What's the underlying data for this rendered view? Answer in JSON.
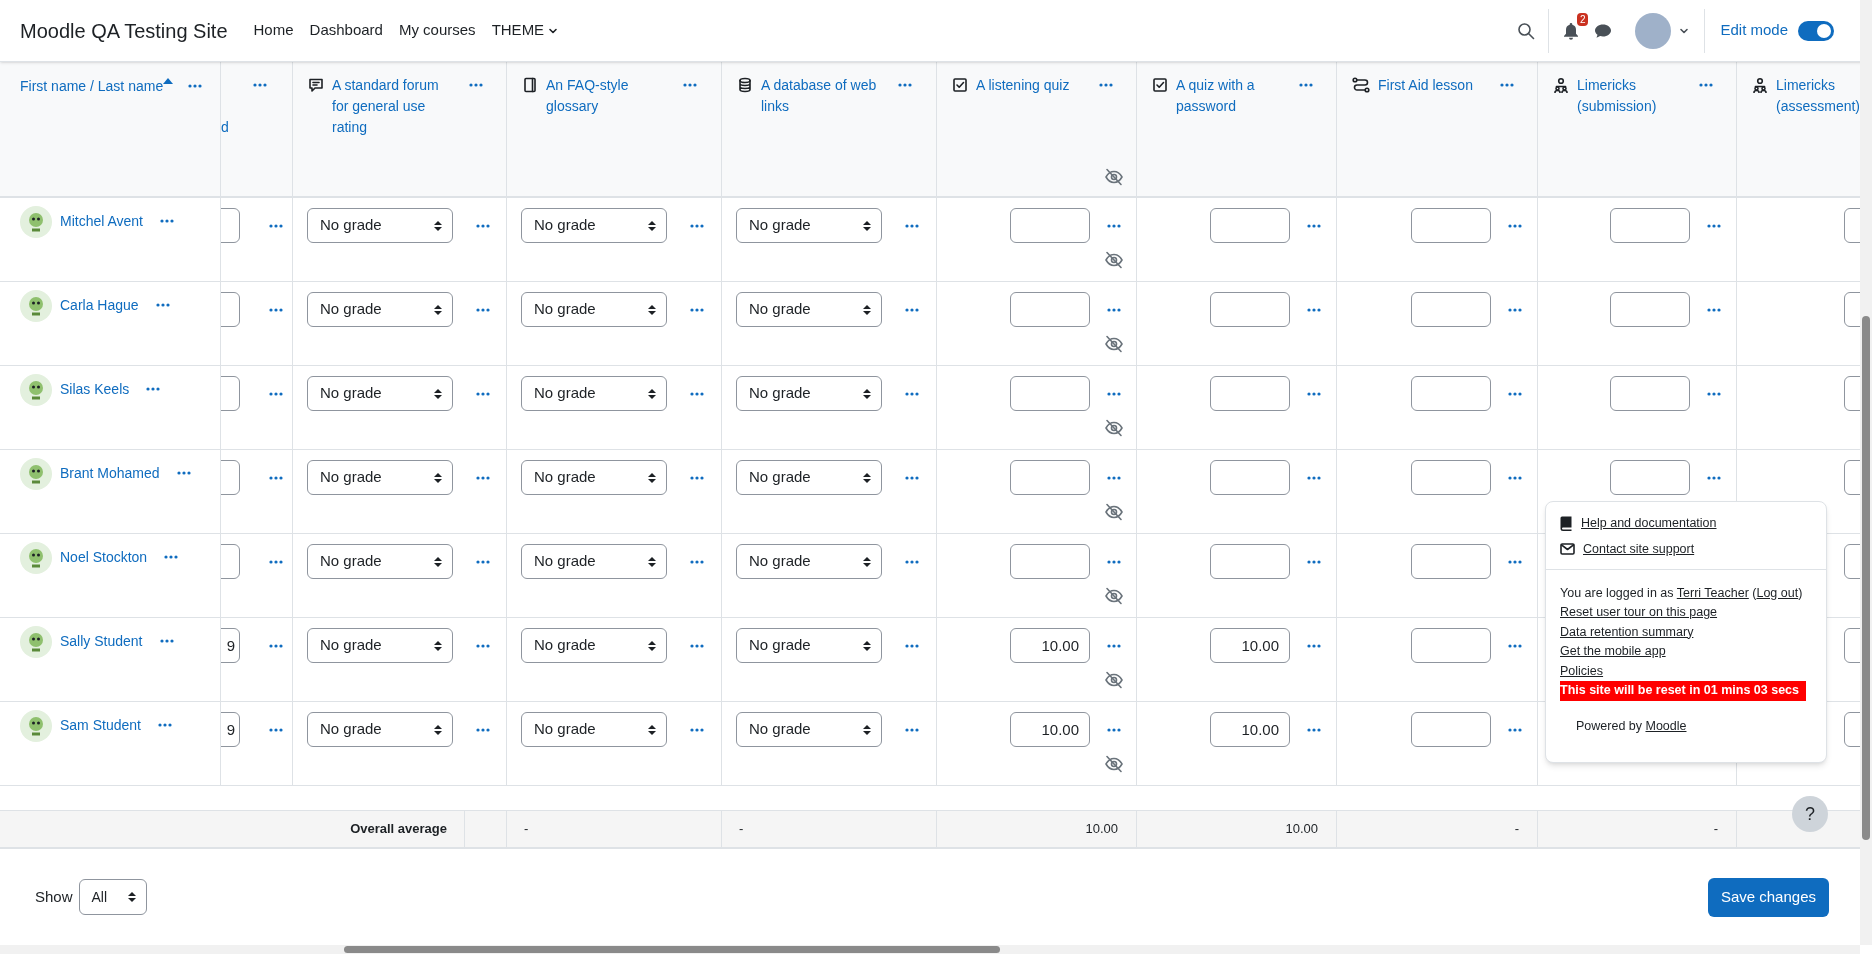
{
  "site_name": "Moodle QA Testing Site",
  "nav": [
    {
      "label": "Home",
      "dropdown": false
    },
    {
      "label": "Dashboard",
      "dropdown": false
    },
    {
      "label": "My courses",
      "dropdown": false
    },
    {
      "label": "THEME",
      "dropdown": true
    }
  ],
  "notifications": {
    "count": "2"
  },
  "edit_mode": {
    "label": "Edit mode",
    "on": true
  },
  "grader": {
    "name_heading": {
      "label": "First name / Last name",
      "sorted": true
    },
    "columns": [
      {
        "kind": "partial",
        "heading": "d"
      },
      {
        "kind": "forum",
        "heading": "A standard forum for general use rating",
        "hidden": false
      },
      {
        "kind": "glossary",
        "heading": "An FAQ-style glossary",
        "hidden": false
      },
      {
        "kind": "database",
        "heading": "A database of web links",
        "hidden": false
      },
      {
        "kind": "quiz",
        "heading": "A listening quiz",
        "hidden": true
      },
      {
        "kind": "quiz",
        "heading": "A quiz with a password",
        "hidden": false
      },
      {
        "kind": "lesson",
        "heading": "First Aid lesson",
        "hidden": false
      },
      {
        "kind": "workshop",
        "heading": "Limericks (submission)",
        "hidden": false
      },
      {
        "kind": "workshop",
        "heading": "Limericks (assessment)",
        "hidden": false
      }
    ],
    "rows": [
      {
        "name": "Mitchel Avent",
        "cells": [
          {},
          {
            "value": "No grade"
          },
          {
            "value": "No grade"
          },
          {
            "value": "No grade"
          },
          {},
          {},
          {},
          {},
          {}
        ]
      },
      {
        "name": "Carla Hague",
        "cells": [
          {},
          {
            "value": "No grade"
          },
          {
            "value": "No grade"
          },
          {
            "value": "No grade"
          },
          {},
          {},
          {},
          {},
          {}
        ]
      },
      {
        "name": "Silas Keels",
        "cells": [
          {},
          {
            "value": "No grade"
          },
          {
            "value": "No grade"
          },
          {
            "value": "No grade"
          },
          {},
          {},
          {},
          {},
          {}
        ]
      },
      {
        "name": "Brant Mohamed",
        "cells": [
          {},
          {
            "value": "No grade"
          },
          {
            "value": "No grade"
          },
          {
            "value": "No grade"
          },
          {},
          {},
          {},
          {},
          {}
        ]
      },
      {
        "name": "Noel Stockton",
        "cells": [
          {},
          {
            "value": "No grade"
          },
          {
            "value": "No grade"
          },
          {
            "value": "No grade"
          },
          {},
          {},
          {},
          {},
          {}
        ]
      },
      {
        "name": "Sally Student",
        "cells": [
          {
            "value": "9"
          },
          {
            "value": "No grade"
          },
          {
            "value": "No grade"
          },
          {
            "value": "No grade"
          },
          {
            "value": "10.00"
          },
          {
            "value": "10.00"
          },
          {},
          {},
          {}
        ]
      },
      {
        "name": "Sam Student",
        "cells": [
          {
            "value": "9"
          },
          {
            "value": "No grade"
          },
          {
            "value": "No grade"
          },
          {
            "value": "No grade"
          },
          {
            "value": "10.00"
          },
          {
            "value": "10.00"
          },
          {},
          {},
          {}
        ]
      }
    ],
    "footer": {
      "label": "Overall average",
      "cells": [
        {
          "value": "-"
        },
        {
          "value": "-"
        },
        {
          "value": "10.00"
        },
        {
          "value": "10.00"
        },
        {
          "value": "-"
        },
        {
          "value": "-"
        }
      ]
    }
  },
  "show": {
    "label": "Show",
    "value": "All"
  },
  "save_button": "Save changes",
  "help_popup": {
    "links": [
      {
        "kind": "help",
        "label": "Help and documentation"
      },
      {
        "kind": "contact",
        "label": "Contact site support"
      }
    ],
    "logged_in": {
      "prefix": "You are logged in as",
      "user": "Terri Teacher",
      "open": "(",
      "logout": "Log out",
      "close": ")"
    },
    "more_links": [
      "Reset user tour on this page",
      "Data retention summary",
      "Get the mobile app",
      "Policies"
    ],
    "reset_notice": "This site will be reset in 01 mins 03 secs",
    "powered": {
      "prefix": "Powered by",
      "link": "Moodle"
    }
  },
  "help_button": "?"
}
